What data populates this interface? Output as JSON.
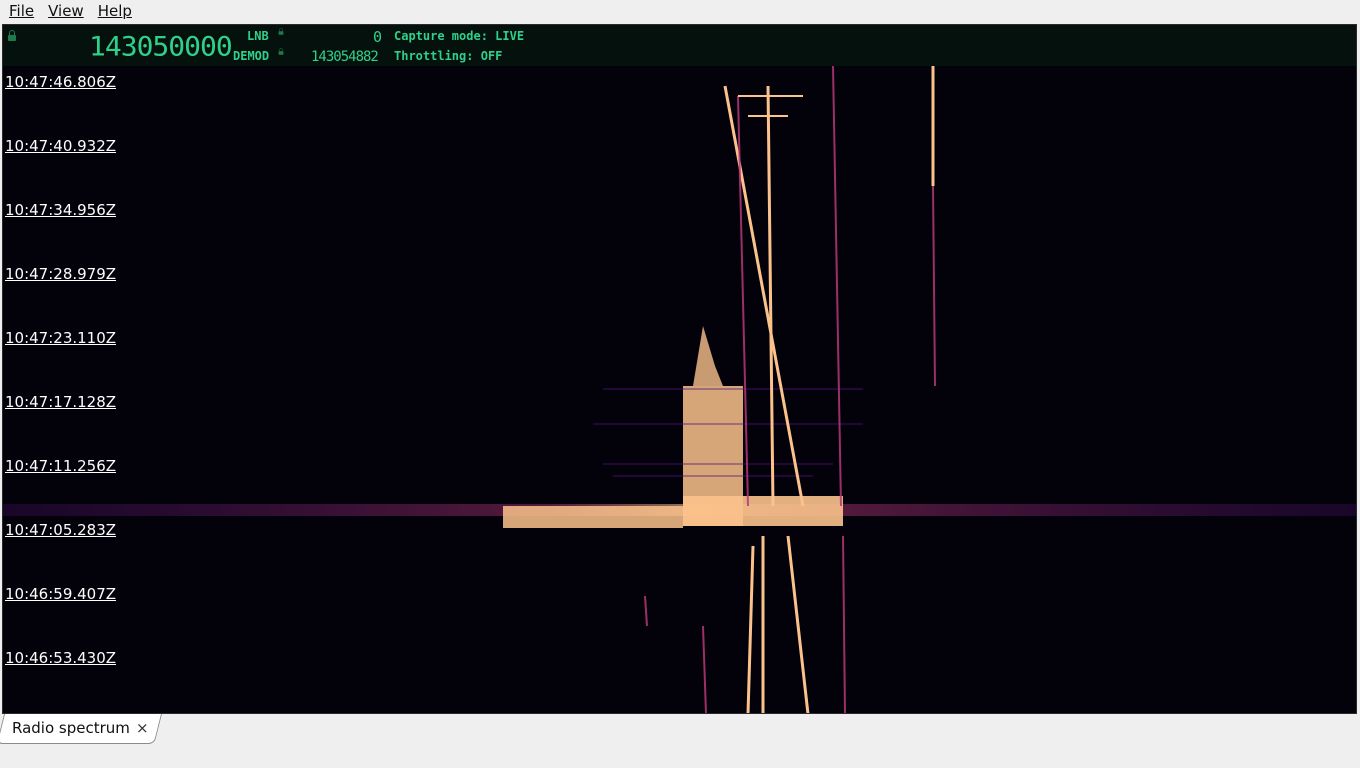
{
  "menu": {
    "file": "File",
    "view": "View",
    "help": "Help"
  },
  "readout": {
    "frequency": "143050000",
    "lnb_label": "LNB",
    "lnb_value": "0",
    "demod_label": "DEMOD",
    "demod_value": "143054882",
    "capture_mode": "Capture mode: LIVE",
    "throttling": "Throttling: OFF"
  },
  "waterfall": {
    "timestamps": [
      "10:47:46.806Z",
      "10:47:40.932Z",
      "10:47:34.956Z",
      "10:47:28.979Z",
      "10:47:23.110Z",
      "10:47:17.128Z",
      "10:47:11.256Z",
      "10:47:05.283Z",
      "10:46:59.407Z",
      "10:46:53.430Z"
    ]
  },
  "tabs": [
    {
      "label": "Radio spectrum",
      "close": "×"
    }
  ],
  "colors": {
    "background": "#03020a",
    "signal_hot": "#fbc28c",
    "signal_mid": "#b73779",
    "signal_low": "#51127c",
    "readout_text": "#2fd08a"
  }
}
